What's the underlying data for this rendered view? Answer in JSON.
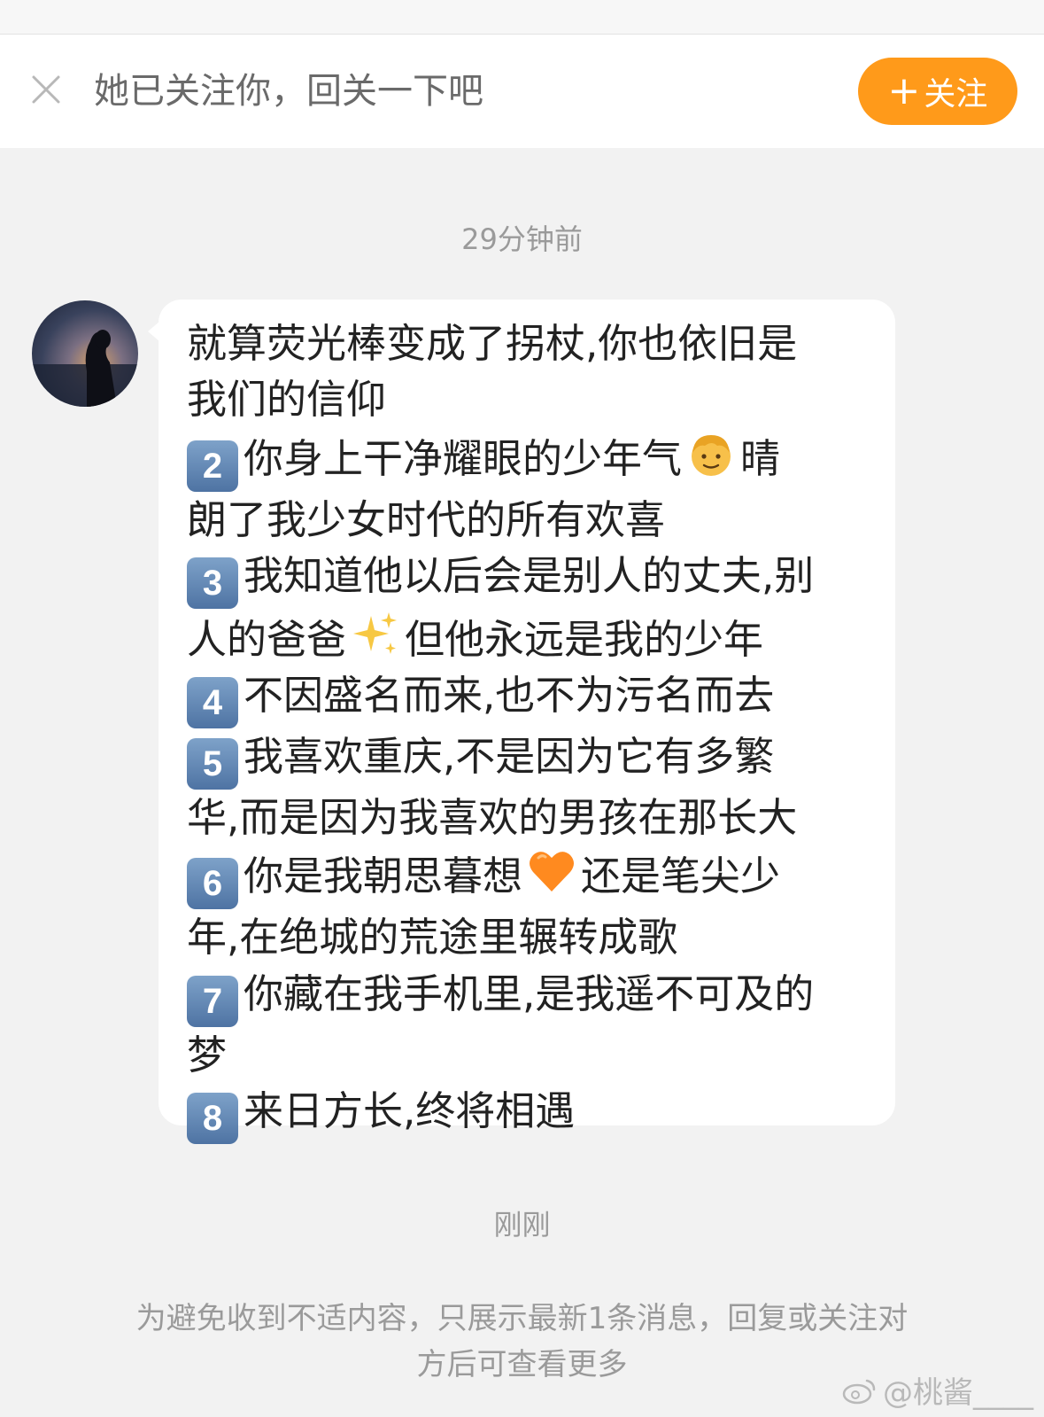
{
  "follow_bar": {
    "prompt": "她已关注你，回关一下吧",
    "follow_button": {
      "plus": "+",
      "label": "关注"
    },
    "accent_color": "#ff9a1a"
  },
  "chat": {
    "timestamps": [
      "29分钟前",
      "刚刚"
    ],
    "message": {
      "lines": [
        "就算荧光棒变成了拐杖,你也依旧是",
        "我们的信仰",
        {
          "key": "2",
          "text": "你身上干净耀眼的少年气",
          "emoji": "boy-emoji",
          "after": "晴"
        },
        "朗了我少女时代的所有欢喜",
        {
          "key": "3",
          "text": "我知道他以后会是别人的丈夫,别"
        },
        {
          "before": "人的爸爸",
          "emoji": "sparkles-emoji",
          "after": "但他永远是我的少年"
        },
        {
          "key": "4",
          "text": "不因盛名而来,也不为污名而去"
        },
        {
          "key": "5",
          "text": "我喜欢重庆,不是因为它有多繁"
        },
        "华,而是因为我喜欢的男孩在那长大",
        {
          "key": "6",
          "text": "你是我朝思暮想",
          "emoji": "orange-heart-emoji",
          "after": "还是笔尖少"
        },
        "年,在绝城的荒途里辗转成歌",
        {
          "key": "7",
          "text": "你藏在我手机里,是我遥不可及的"
        },
        "梦",
        {
          "key": "8",
          "text": "来日方长,终将相遇"
        }
      ]
    }
  },
  "notice": {
    "line1": "为避免收到不适内容，只展示最新1条消息，回复或关注对",
    "line2": "方后可查看更多"
  },
  "watermark": "@桃酱____"
}
